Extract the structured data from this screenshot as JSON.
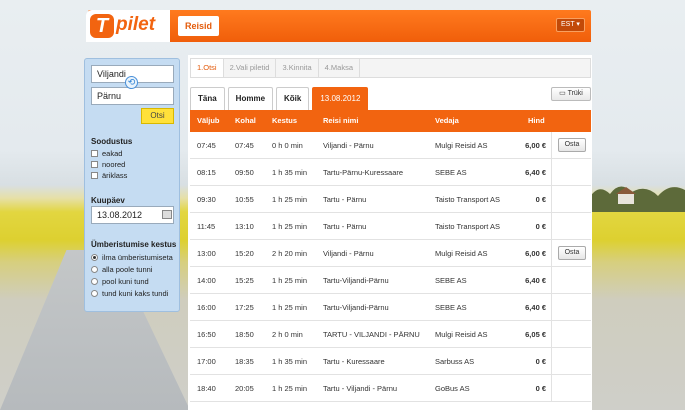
{
  "header": {
    "logo_letter": "T",
    "logo_text": "pilet",
    "nav_item": "Reisid",
    "language": "EST ▾"
  },
  "search": {
    "from": "Viljandi",
    "to": "Pärnu",
    "submit_label": "Otsi"
  },
  "discount": {
    "title": "Soodustus",
    "options": [
      "eakad",
      "noored",
      "äriklass"
    ]
  },
  "date": {
    "title": "Kuupäev",
    "value": "13.08.2012"
  },
  "transfer": {
    "title": "Ümberistumise kestus",
    "options": [
      "ilma ümberistumiseta",
      "alla poole tunni",
      "pool kuni tund",
      "tund kuni kaks tundi"
    ],
    "selected": 0
  },
  "steps": [
    "1.Otsi",
    "2.Vali piletid",
    "3.Kinnita",
    "4.Maksa"
  ],
  "day_tabs": [
    "Täna",
    "Homme",
    "Kõik",
    "13.08.2012"
  ],
  "print_label": "Trüki",
  "table": {
    "columns": [
      "Väljub",
      "Kohal",
      "Kestus",
      "Reisi nimi",
      "Vedaja",
      "Hind"
    ],
    "buy_label": "Osta",
    "rows": [
      [
        "07:45",
        "07:45",
        "0 h 0 min",
        "Viljandi - Pärnu",
        "Mulgi Reisid AS",
        "6,00 €",
        true
      ],
      [
        "08:15",
        "09:50",
        "1 h 35 min",
        "Tartu-Pärnu-Kuressaare",
        "SEBE AS",
        "6,40 €",
        false
      ],
      [
        "09:30",
        "10:55",
        "1 h 25 min",
        "Tartu - Pärnu",
        "Taisto Transport AS",
        "0 €",
        false
      ],
      [
        "11:45",
        "13:10",
        "1 h 25 min",
        "Tartu - Pärnu",
        "Taisto Transport AS",
        "0 €",
        false
      ],
      [
        "13:00",
        "15:20",
        "2 h 20 min",
        "Viljandi - Pärnu",
        "Mulgi Reisid AS",
        "6,00 €",
        true
      ],
      [
        "14:00",
        "15:25",
        "1 h 25 min",
        "Tartu-Viljandi-Pärnu",
        "SEBE AS",
        "6,40 €",
        false
      ],
      [
        "16:00",
        "17:25",
        "1 h 25 min",
        "Tartu-Viljandi-Pärnu",
        "SEBE AS",
        "6,40 €",
        false
      ],
      [
        "16:50",
        "18:50",
        "2 h 0 min",
        "TARTU - VILJANDI - PÄRNU",
        "Mulgi Reisid AS",
        "6,05 €",
        false
      ],
      [
        "17:00",
        "18:35",
        "1 h 35 min",
        "Tartu - Kuressaare",
        "Sarbuss AS",
        "0 €",
        false
      ],
      [
        "18:40",
        "20:05",
        "1 h 25 min",
        "Tartu - Viljandi - Pärnu",
        "GoBus AS",
        "0 €",
        false
      ]
    ]
  }
}
